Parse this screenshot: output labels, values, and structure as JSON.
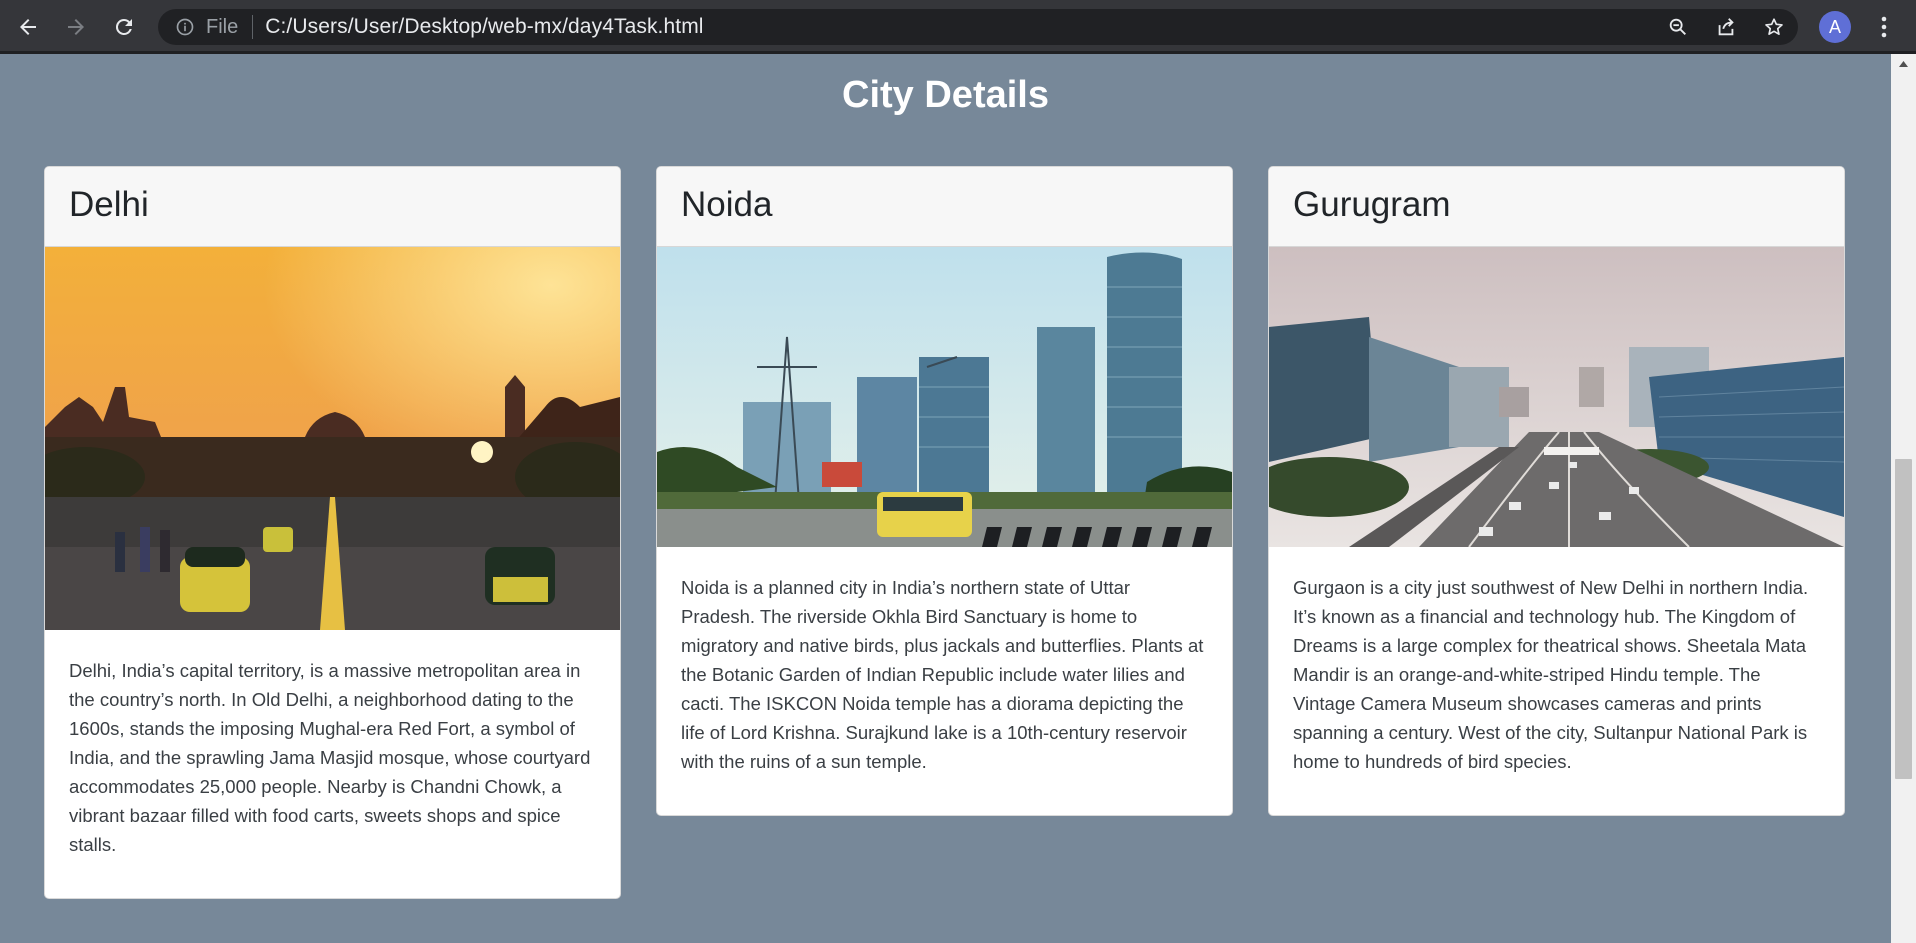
{
  "browser": {
    "file_label": "File",
    "url": "C:/Users/User/Desktop/web-mx/day4Task.html",
    "avatar_letter": "A",
    "icons": [
      "back-arrow-icon",
      "forward-arrow-icon",
      "reload-icon",
      "info-icon",
      "zoom-icon",
      "share-icon",
      "star-icon",
      "more-vert-icon"
    ]
  },
  "page": {
    "title": "City Details",
    "background": "#778899",
    "cards": [
      {
        "name": "Delhi",
        "image_alt": "Rajpath at sunset with auto rickshaws",
        "description": "Delhi, India’s capital territory, is a massive metropolitan area in the country’s north. In Old Delhi, a neighborhood dating to the 1600s, stands the imposing Mughal-era Red Fort, a symbol of India, and the sprawling Jama Masjid mosque, whose courtyard accommodates 25,000 people. Nearby is Chandni Chowk, a vibrant bazaar filled with food carts, sweets shops and spice stalls."
      },
      {
        "name": "Noida",
        "image_alt": "Noida skyline with towers under construction",
        "description": "Noida is a planned city in India’s northern state of Uttar Pradesh. The riverside Okhla Bird Sanctuary is home to migratory and native birds, plus jackals and butterflies. Plants at the Botanic Garden of Indian Republic include water lilies and cacti. The ISKCON Noida temple has a diorama depicting the life of Lord Krishna. Surajkund lake is a 10th-century reservoir with the ruins of a sun temple."
      },
      {
        "name": "Gurugram",
        "image_alt": "Gurugram highway with office buildings",
        "description": "Gurgaon is a city just southwest of New Delhi in northern India. It’s known as a financial and technology hub. The Kingdom of Dreams is a large complex for theatrical shows. Sheetala Mata Mandir is an orange-and-white-striped Hindu temple. The Vintage Camera Museum showcases cameras and prints spanning a century. West of the city, Sultanpur National Park is home to hundreds of bird species."
      }
    ]
  }
}
